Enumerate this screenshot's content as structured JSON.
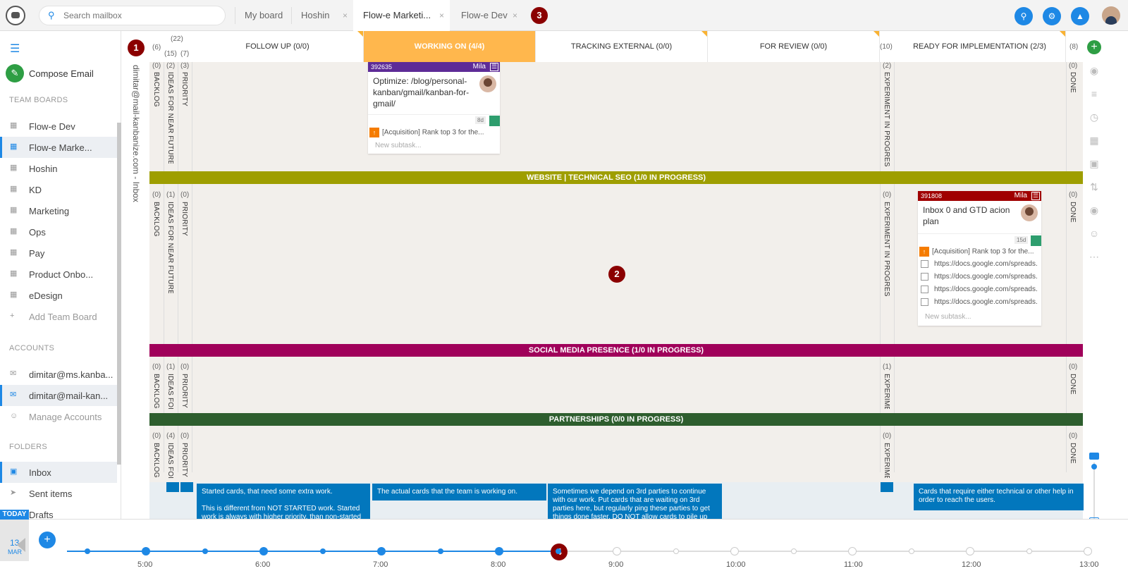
{
  "search": {
    "placeholder": "Search mailbox"
  },
  "tabs": [
    {
      "label": "My board"
    },
    {
      "label": "Hoshin"
    },
    {
      "label": "Flow-e Marketi..."
    },
    {
      "label": "Flow-e Dev"
    }
  ],
  "close_glyph": "×",
  "badges": [
    "1",
    "2",
    "3",
    "4"
  ],
  "sidebar": {
    "compose": "Compose Email",
    "team_boards_title": "TEAM BOARDS",
    "team_boards": [
      "Flow-e Dev",
      "Flow-e Marke...",
      "Hoshin",
      "KD",
      "Marketing",
      "Ops",
      "Pay",
      "Product Onbo...",
      "eDesign"
    ],
    "add_board": "Add Team Board",
    "accounts_title": "ACCOUNTS",
    "accounts": [
      "dimitar@ms.kanba...",
      "dimitar@mail-kan..."
    ],
    "manage_accounts": "Manage Accounts",
    "folders_title": "FOLDERS",
    "folders": [
      "Inbox",
      "Sent items",
      "Drafts"
    ]
  },
  "vertical_account": "dimitar@mail-kanbanize.com  -  Inbox",
  "columns": {
    "narrow_counts": [
      "(6)",
      "(22)",
      "(15)",
      "(7)"
    ],
    "headers": [
      {
        "label": "FOLLOW UP (0/0)"
      },
      {
        "label": "WORKING ON (4/4)"
      },
      {
        "label": "TRACKING EXTERNAL (0/0)"
      },
      {
        "label": "FOR REVIEW (0/0)"
      },
      {
        "label": "READY FOR IMPLEMENTATION (2/3)"
      }
    ],
    "experiment_count": "(10)",
    "done_count": "(8)"
  },
  "labels": {
    "backlog": "BACKLOG",
    "ideas": "IDEAS FOR NEAR FUTURE",
    "ideas_short": "IDEAS FOR",
    "priority": "PRIORITY",
    "experiment": "EXPERIMENT IN PROGRESS",
    "experiment_short": "EXPERIMEN",
    "done": "DONE"
  },
  "lanes": [
    {
      "title": "WEBSITE | TECHNICAL SEO (1/0 IN PROGRESS)",
      "color": "#9e9e00"
    },
    {
      "title": "SOCIAL MEDIA PRESENCE (1/0 IN PROGRESS)",
      "color": "#a0005a"
    },
    {
      "title": "PARTNERSHIPS (0/0 IN PROGRESS)",
      "color": "#2e5e2e"
    }
  ],
  "row_counts": [
    [
      "(0)",
      "(2)",
      "(3)",
      "(2)",
      "(0)"
    ],
    [
      "(0)",
      "(1)",
      "(0)",
      "(0)",
      "(0)"
    ],
    [
      "(0)",
      "(1)",
      "(0)",
      "(1)",
      "(0)"
    ],
    [
      "(0)",
      "(4)",
      "(0)",
      "(0)",
      "(0)"
    ]
  ],
  "cards": [
    {
      "id": "392635",
      "owner": "Mila",
      "color": "#5e2b97",
      "title": "Optimize: /blog/personal-kanban/gmail/kanban-for-gmail/",
      "age": "8d",
      "subtask": "[Acquisition] Rank top 3 for the...",
      "new_subtask": "New subtask..."
    },
    {
      "id": "391808",
      "owner": "Mila",
      "color": "#a00000",
      "title": "Inbox 0 and GTD acion plan",
      "age": "15d",
      "subtask": "[Acquisition] Rank top 3 for the...",
      "checklist": [
        "https://docs.google.com/spreads...",
        "https://docs.google.com/spreads...",
        "https://docs.google.com/spreads...",
        "https://docs.google.com/spreads..."
      ],
      "new_subtask": "New subtask..."
    }
  ],
  "menu_glyph": "☰",
  "arrow_glyph": "↑",
  "notes": [
    "Started cards, that need some extra work.\n\nThis is different from NOT STARTED work. Started work is always with higher priority, than non-started (unless explicitly noted).",
    "The actual cards that the team is working on.",
    "Sometimes we depend on 3rd parties to continue with our work. Put cards that are waiting on 3rd parties here, but regularly ping these parties to get things done faster. DO NOT allow cards to pile up here.",
    "Cards that require either technical or other help in order to reach the users."
  ],
  "timeline": {
    "today": "TODAY",
    "date_day": "13",
    "date_month": "MAR",
    "hours": [
      "5:00",
      "6:00",
      "7:00",
      "8:00",
      "9:00",
      "10:00",
      "11:00",
      "12:00",
      "13:00"
    ]
  },
  "icons": {
    "search": "search-icon",
    "settings": "people-settings-icon",
    "academy": "graduation-cap-icon",
    "rail": [
      "add-icon",
      "tag-icon",
      "filter-icon",
      "clock-icon",
      "board-icon",
      "image-icon",
      "sort-icon",
      "visibility-icon",
      "add-user-icon",
      "more-icon"
    ]
  },
  "colors": {
    "accent": "#1e88e5",
    "active_column": "#ffb74d",
    "note": "#0277bd"
  }
}
